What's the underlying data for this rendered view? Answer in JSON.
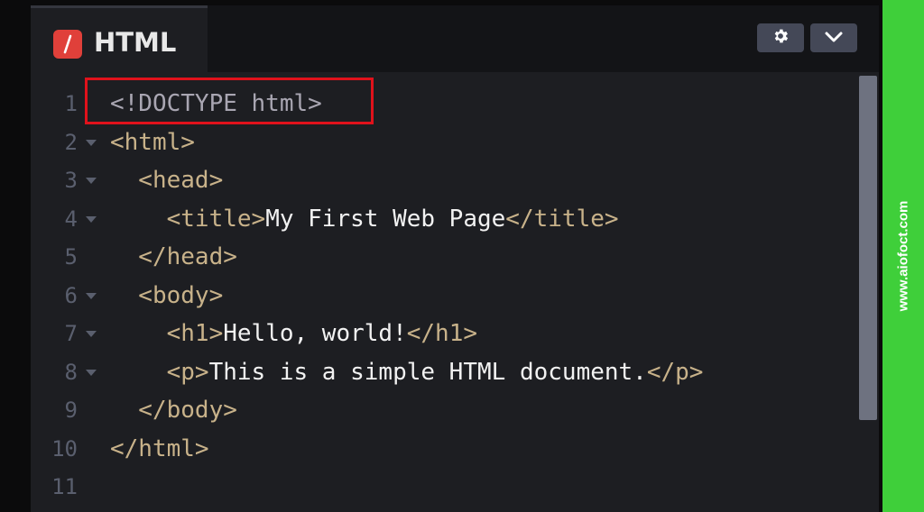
{
  "tab": {
    "icon": "slash-logo-icon",
    "label": "HTML"
  },
  "toolbar": {
    "settings_icon": "gear-icon",
    "collapse_icon": "chevron-down-icon"
  },
  "colors": {
    "accent_red": "#e0403a",
    "highlight_box": "#e0121b",
    "tag": "#c8b28a",
    "text": "#f2f2f2",
    "watermark_bg": "#3fcf3a"
  },
  "code": {
    "lines": [
      {
        "num": "1",
        "fold": false,
        "parts": [
          {
            "cls": "doctype",
            "text": "<!DOCTYPE html>"
          }
        ]
      },
      {
        "num": "2",
        "fold": true,
        "parts": [
          {
            "cls": "tag",
            "text": "<html>"
          }
        ]
      },
      {
        "num": "3",
        "fold": true,
        "parts": [
          {
            "cls": "tag",
            "text": "  <head>"
          }
        ]
      },
      {
        "num": "4",
        "fold": true,
        "parts": [
          {
            "cls": "tag",
            "text": "    <title>"
          },
          {
            "cls": "txt",
            "text": "My First Web Page"
          },
          {
            "cls": "tag",
            "text": "</title>"
          }
        ]
      },
      {
        "num": "5",
        "fold": false,
        "parts": [
          {
            "cls": "tag",
            "text": "  </head>"
          }
        ]
      },
      {
        "num": "6",
        "fold": true,
        "parts": [
          {
            "cls": "tag",
            "text": "  <body>"
          }
        ]
      },
      {
        "num": "7",
        "fold": true,
        "parts": [
          {
            "cls": "tag",
            "text": "    <h1>"
          },
          {
            "cls": "txt",
            "text": "Hello, world!"
          },
          {
            "cls": "tag",
            "text": "</h1>"
          }
        ]
      },
      {
        "num": "8",
        "fold": true,
        "parts": [
          {
            "cls": "tag",
            "text": "    <p>"
          },
          {
            "cls": "txt",
            "text": "This is a simple HTML document."
          },
          {
            "cls": "tag",
            "text": "</p>"
          }
        ]
      },
      {
        "num": "9",
        "fold": false,
        "parts": [
          {
            "cls": "tag",
            "text": "  </body>"
          }
        ]
      },
      {
        "num": "10",
        "fold": false,
        "parts": [
          {
            "cls": "tag",
            "text": "</html>"
          }
        ]
      },
      {
        "num": "11",
        "fold": false,
        "parts": []
      }
    ]
  },
  "watermark": {
    "text": "www.aiofoct.com"
  }
}
